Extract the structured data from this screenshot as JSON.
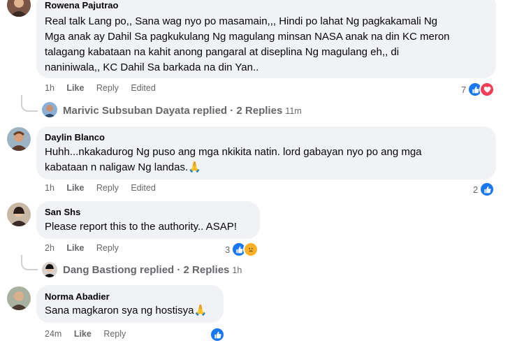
{
  "comments": [
    {
      "name": "Rowena Pajutrao",
      "text_lines": [
        "Real talk Lang po,, Sana wag nyo po masamain,,, Hindi po lahat Ng pagkakamali Ng",
        "Mga anak ay Dahil Sa pagkukulang Ng magulang minsan NASA anak na din KC meron",
        "talagang kabataan na kahit anong pangaral at diseplina Ng magulang eh,, di",
        "naniniwala,, KC Dahil Sa barkada na din Yan.."
      ],
      "time": "1h",
      "like": "Like",
      "reply": "Reply",
      "edited": "Edited",
      "reaction_count": "7",
      "reactions": [
        "like-icon",
        "heart-icon"
      ],
      "thread": {
        "name": "Marivic Subsuban Dayata",
        "label": "replied · 2 Replies",
        "time": "11m"
      }
    },
    {
      "name": "Daylin Blanco",
      "text_lines": [
        "Huhh...nkakadurog Ng puso ang mga nkikita natin. lord gabayan nyo po ang mga",
        "kabataan n naligaw Ng landas."
      ],
      "emoji": "🙏",
      "time": "1h",
      "like": "Like",
      "reply": "Reply",
      "edited": "Edited",
      "reaction_count": "2",
      "reactions": [
        "like-icon"
      ]
    },
    {
      "name": "San Shs",
      "text_lines": [
        "Please report this to the authority.. ASAP!"
      ],
      "time": "2h",
      "like": "Like",
      "reply": "Reply",
      "reaction_count": "3",
      "reactions": [
        "like-icon",
        "sad-icon"
      ],
      "thread": {
        "name": "Dang Bastiong",
        "label": "replied · 2 Replies",
        "time": "1h"
      }
    },
    {
      "name": "Norma Abadier",
      "text_lines": [
        "Sana magkaron sya ng hostisya"
      ],
      "emoji": "🙏",
      "time": "24m",
      "like": "Like",
      "reply": "Reply",
      "reactions": [
        "like-icon"
      ]
    }
  ],
  "colors": {
    "like": "#1877f2",
    "heart": "#f33e58",
    "sad": "#f7b125",
    "bubble": "#f0f2f5",
    "meta": "#65676b"
  }
}
